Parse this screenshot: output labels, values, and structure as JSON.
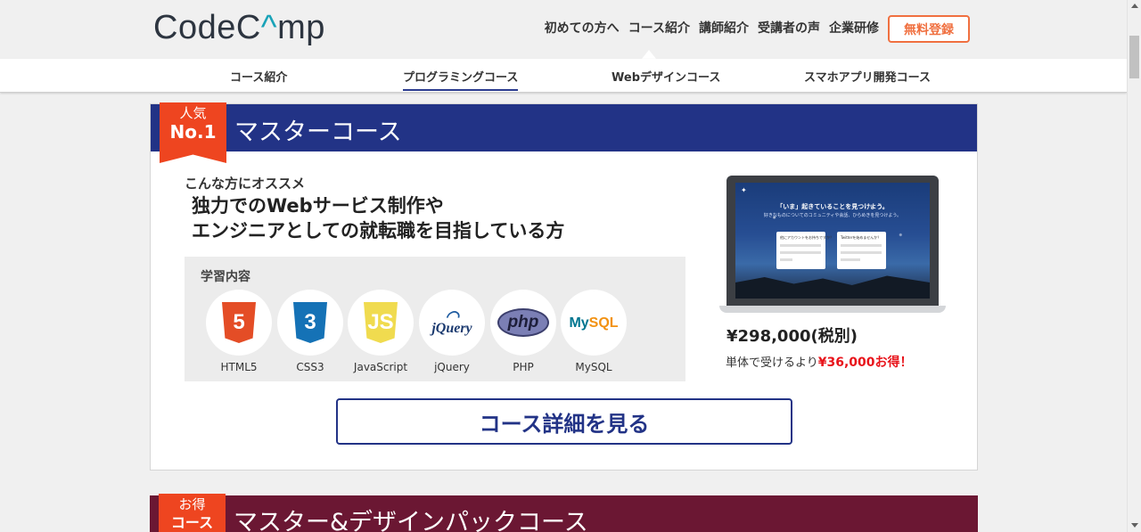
{
  "header": {
    "logo_left": "CodeC",
    "logo_a": "a",
    "logo_right": "mp",
    "nav": [
      "初めての方へ",
      "コース紹介",
      "講師紹介",
      "受講者の声",
      "企業研修"
    ],
    "register": "無料登録"
  },
  "subnav": {
    "items": [
      "コース紹介",
      "プログラミングコース",
      "Webデザインコース",
      "スマホアプリ開発コース"
    ],
    "selected": "プログラミングコース"
  },
  "card1": {
    "ribbon_top": "人気",
    "ribbon_bottom": "No.1",
    "title": "マスターコース",
    "recommend": "こんな方にオススメ",
    "headline_1": "独力でのWebサービス制作や",
    "headline_2": "エンジニアとしての就転職を目指している方",
    "learn_title": "学習内容",
    "skills": [
      "HTML5",
      "CSS3",
      "JavaScript",
      "jQuery",
      "PHP",
      "MySQL"
    ],
    "price": "¥298,000(税別)",
    "saving_prefix": "単体で受けるより",
    "saving_amount": "¥36,000お得！",
    "detail_button": "コース詳細を見る",
    "screen": {
      "title": "「いま」起きていることを見つけよう。",
      "subtitle": "好きなものについてのコミュニティや会話、ひらめきを見つけよう。",
      "form_left": "他にアカウントをお持ちですか？",
      "form_right": "Twitterを始めませんか？"
    }
  },
  "card2": {
    "ribbon_top": "お得",
    "ribbon_bottom": "コース",
    "title": "マスター&デザインパックコース"
  },
  "colors": {
    "primary_navy": "#223386",
    "accent_orange": "#ee4520",
    "pack_maroon": "#6b1733",
    "save_red": "#e8141b"
  }
}
